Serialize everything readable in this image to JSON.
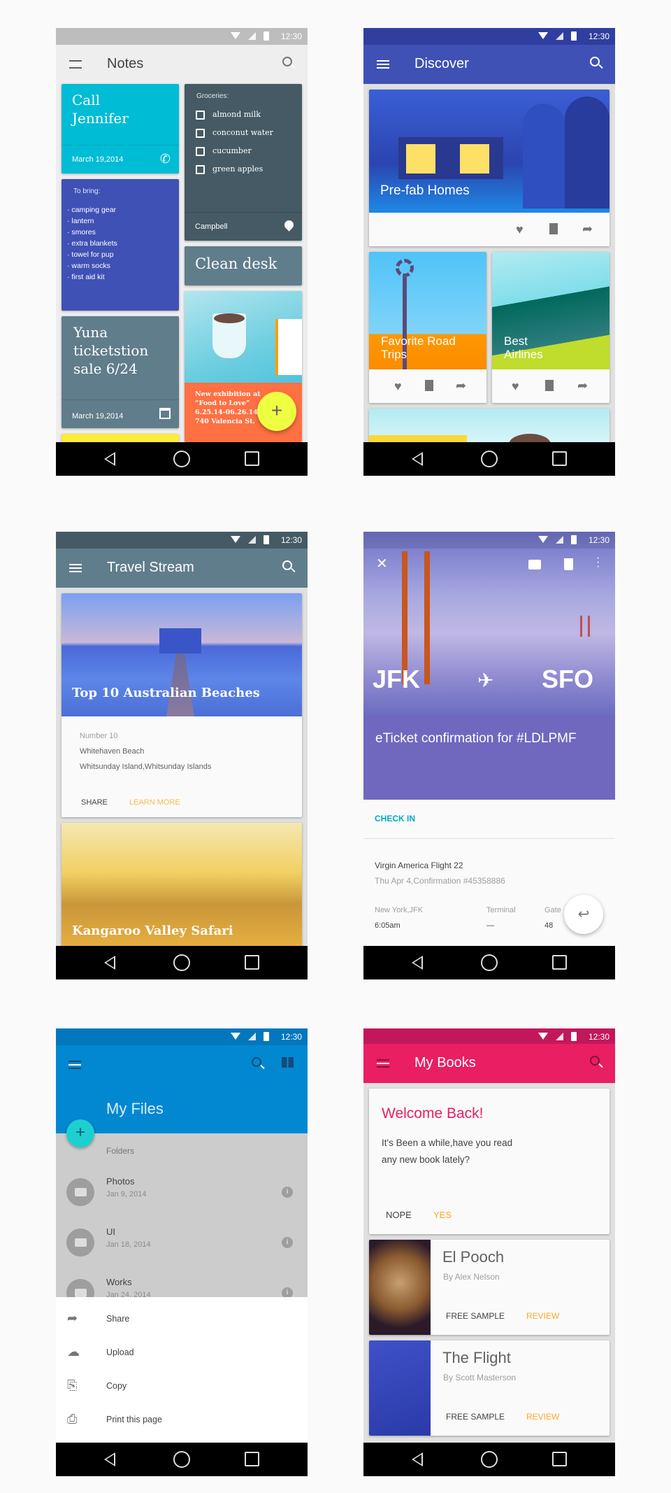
{
  "status": {
    "time": "12:30"
  },
  "notes": {
    "title": "Notes",
    "call": {
      "title": "Call Jennifer",
      "date": "March 19,2014"
    },
    "bring": {
      "heading": "To bring:",
      "items": [
        "camping gear",
        "lantern",
        "smores",
        "extra blankets",
        "towel for pup",
        "warm socks",
        "first aid kit"
      ]
    },
    "yuna": {
      "title": "Yuna ticketstion sale 6/24",
      "date": "March 19,2014"
    },
    "groceries": {
      "heading": "Groceries:",
      "items": [
        "almond milk",
        "conconut water",
        "cucumber",
        "green apples"
      ],
      "location": "Campbell"
    },
    "clean": {
      "title": "Clean desk"
    },
    "exhibit": {
      "lines": [
        "New exhibition at",
        "“Food to Love”",
        "6.25.14-06.26.14",
        "740 Valencia St."
      ]
    },
    "fab": "+"
  },
  "discover": {
    "title": "Discover",
    "cards": [
      {
        "title": "Pre-fab Homes"
      },
      {
        "title": "Favorite Road Trips"
      },
      {
        "title": "Best Airlines"
      }
    ]
  },
  "travel": {
    "title": "Travel Stream",
    "card1": {
      "title": "Top 10 Australian Beaches",
      "number": "Number 10",
      "name": "Whitehaven Beach",
      "place": "Whitsunday Island,Whitsunday Islands",
      "share": "SHARE",
      "learn": "LEARN MORE"
    },
    "card2": {
      "title": "Kangaroo Valley Safari"
    }
  },
  "ticket": {
    "from": "JFK",
    "to": "SFO",
    "plane": "✈",
    "heading": "eTicket confirmation for #LDLPMF",
    "checkin": "CHECK IN",
    "flight": "Virgin America Flight 22",
    "date": "Thu Apr 4,Confirmation #45358886",
    "cols": [
      {
        "label": "New York,JFK",
        "value": "6:05am"
      },
      {
        "label": "Terminal",
        "value": "—"
      },
      {
        "label": "Gate",
        "value": "48"
      }
    ]
  },
  "files": {
    "title": "My Files",
    "section": "Folders",
    "folders": [
      {
        "name": "Photos",
        "date": "Jan 9, 2014"
      },
      {
        "name": "UI",
        "date": "Jan 18, 2014"
      },
      {
        "name": "Works",
        "date": "Jan 24, 2014"
      }
    ],
    "sheet": [
      {
        "label": "Share",
        "icon": "share-icon"
      },
      {
        "label": "Upload",
        "icon": "upload-icon"
      },
      {
        "label": "Copy",
        "icon": "copy-icon"
      },
      {
        "label": "Print this page",
        "icon": "print-icon"
      }
    ]
  },
  "books": {
    "title": "My Books",
    "welcome": {
      "title": "Welcome Back!",
      "text": "It's Been a while,have you read any new book lately?",
      "nope": "NOPE",
      "yes": "YES"
    },
    "list": [
      {
        "title": "El Pooch",
        "author": "By Alex Nelson",
        "sample": "FREE SAMPLE",
        "review": "REVIEW"
      },
      {
        "title": "The Flight",
        "author": "By Scott Masterson",
        "sample": "FREE SAMPLE",
        "review": "REVIEW"
      }
    ]
  },
  "colors": {
    "notes_status": "#bdbdbd",
    "indigo": "#3f51b5",
    "bluegrey": "#607d8b",
    "pink": "#e91e63",
    "files_blue": "#0288d1",
    "accent_orange": "#ffa726",
    "teal": "#00acc1"
  }
}
